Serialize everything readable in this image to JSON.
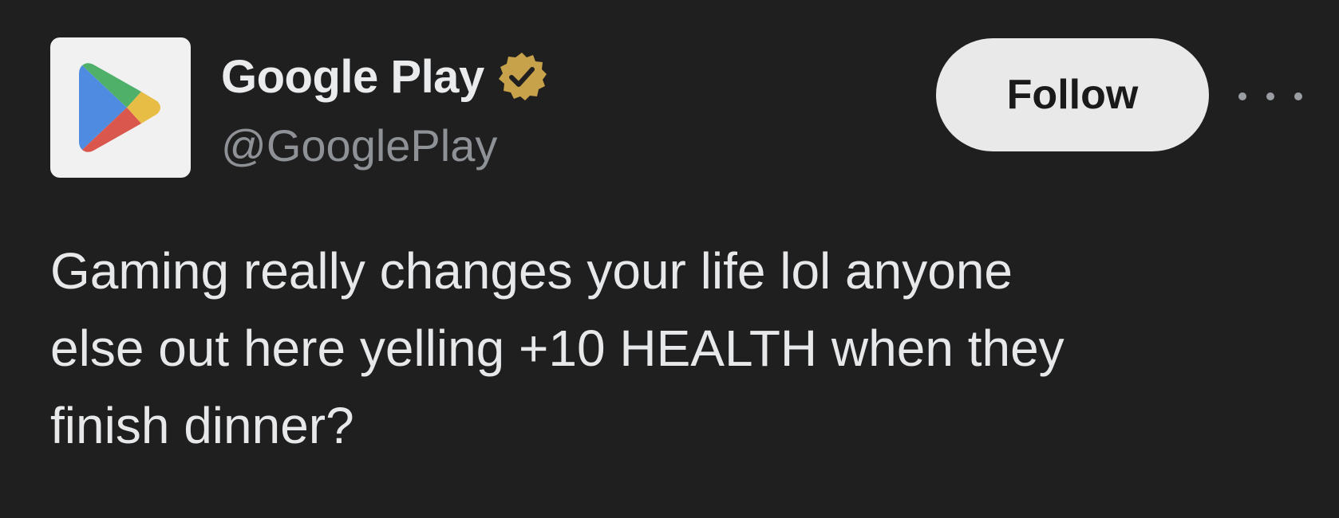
{
  "account": {
    "display_name": "Google Play",
    "handle": "@GooglePlay",
    "avatar_icon": "google-play-logo-icon",
    "verified_icon": "verified-badge-icon",
    "verified_color": "#c7a24a"
  },
  "actions": {
    "follow_label": "Follow",
    "more_icon": "more-options-icon"
  },
  "tweet": {
    "text": "Gaming really changes your life lol anyone\nelse out here yelling +10 HEALTH when they\nfinish dinner?"
  },
  "colors": {
    "background": "#1f1f1f",
    "follow_button_bg": "#e9e9e9",
    "handle_text": "#8e9196",
    "body_text": "#e6e8ea"
  }
}
